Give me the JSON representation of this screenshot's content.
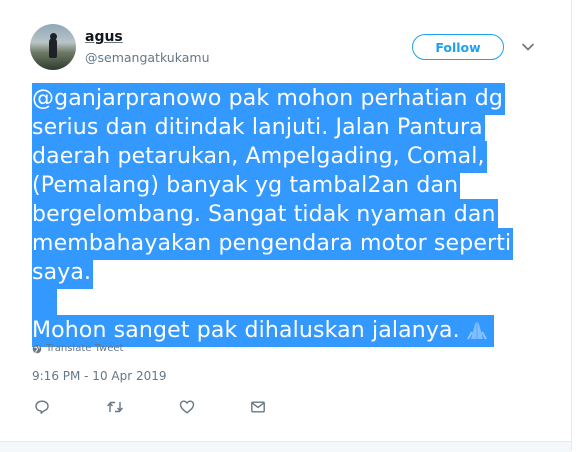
{
  "user": {
    "name": "agus",
    "handle": "@semangatkukamu"
  },
  "follow_label": "Follow",
  "tweet": {
    "paragraph1": "@ganjarpranowo pak mohon perhatian dg serius dan ditindak lanjuti. Jalan Pantura daerah petarukan, Ampelgading, Comal, (Pemalang) banyak yg tambal2an dan bergelombang. Sangat tidak nyaman dan membahayakan pengendara motor seperti saya.",
    "paragraph2": "Mohon sanget pak dihaluskan jalanya."
  },
  "translate_label": "Translate Tweet",
  "timestamp": "9:16 PM - 10 Apr 2019",
  "actions": [
    "reply-icon",
    "retweet-icon",
    "like-icon",
    "message-icon"
  ],
  "colors": {
    "accent": "#1da1f2",
    "selection": "#3399ff",
    "muted": "#657786"
  }
}
